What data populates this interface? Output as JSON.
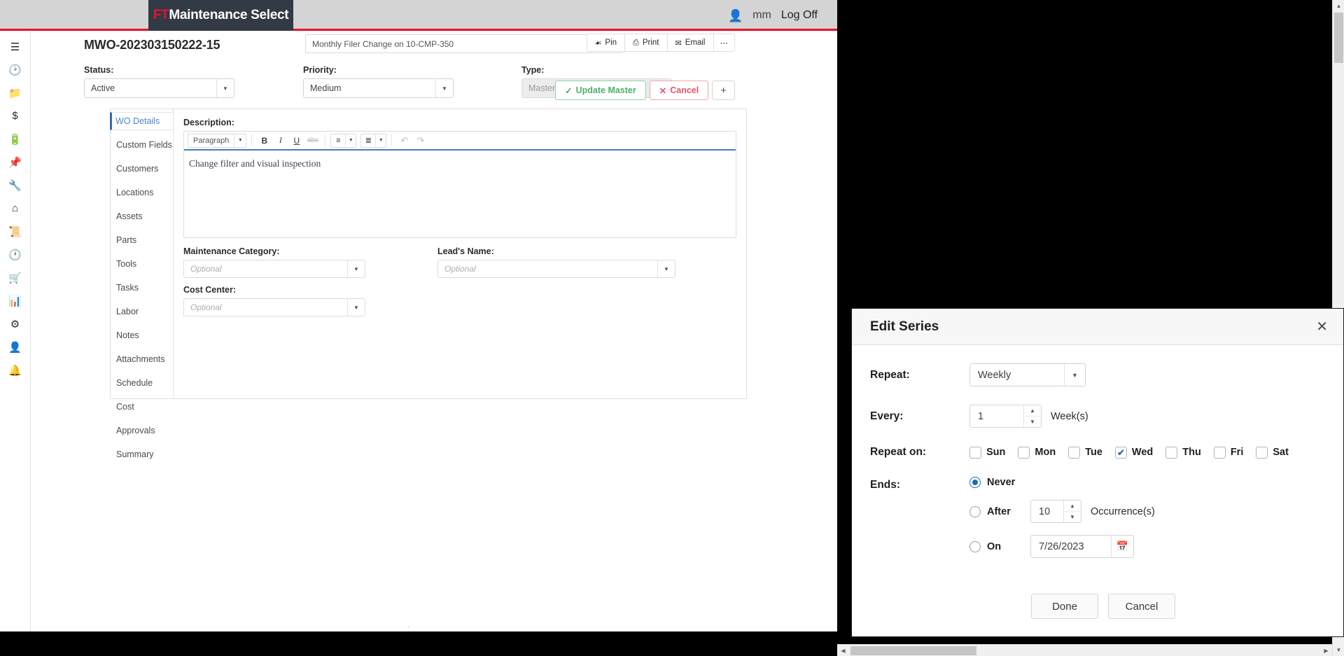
{
  "topbar": {
    "logo_prefix": "FT",
    "logo_rest": "Maintenance Select",
    "user_icon": "user-icon",
    "user_name": "mm",
    "logoff_label": "Log Off"
  },
  "rail": {
    "items": [
      {
        "name": "menu-hamburger",
        "glyph": "☰"
      },
      {
        "name": "clock",
        "glyph": "◴"
      },
      {
        "name": "folder",
        "glyph": "📁"
      },
      {
        "name": "dollar",
        "glyph": "$"
      },
      {
        "name": "battery",
        "glyph": "🗔"
      },
      {
        "name": "pin",
        "glyph": "📌"
      },
      {
        "name": "wrench",
        "glyph": "🔧"
      },
      {
        "name": "home",
        "glyph": "⌂"
      },
      {
        "name": "document",
        "glyph": "📑"
      },
      {
        "name": "history",
        "glyph": "◴"
      },
      {
        "name": "cart",
        "glyph": "🛒"
      },
      {
        "name": "chart",
        "glyph": "📊"
      },
      {
        "name": "gear",
        "glyph": "⚙"
      },
      {
        "name": "person",
        "glyph": "👤"
      },
      {
        "name": "bell",
        "glyph": "🔔"
      }
    ]
  },
  "work_order": {
    "id": "MWO-202303150222-15",
    "title": "Monthly Filer Change on 10-CMP-350",
    "header_actions": [
      {
        "name": "pin-button",
        "label": "Pin",
        "icon": "⍑"
      },
      {
        "name": "print-button",
        "label": "Print",
        "icon": "⎙"
      },
      {
        "name": "email-button",
        "label": "Email",
        "icon": "✉"
      },
      {
        "name": "more-button",
        "label": "⋯",
        "icon": ""
      }
    ],
    "fields": {
      "status_label": "Status:",
      "status_value": "Active",
      "priority_label": "Priority:",
      "priority_value": "Medium",
      "type_label": "Type:",
      "type_value": "Master"
    },
    "commit": {
      "update_label": "Update Master",
      "update_icon": "✓",
      "cancel_label": "Cancel",
      "cancel_icon": "✕",
      "add_label": "+"
    }
  },
  "tabs": [
    {
      "label": "WO Details",
      "active": true
    },
    {
      "label": "Custom Fields",
      "active": false
    },
    {
      "label": "Customers",
      "active": false
    },
    {
      "label": "Locations",
      "active": false
    },
    {
      "label": "Assets",
      "active": false
    },
    {
      "label": "Parts",
      "active": false
    },
    {
      "label": "Tools",
      "active": false
    },
    {
      "label": "Tasks",
      "active": false
    },
    {
      "label": "Labor",
      "active": false
    },
    {
      "label": "Notes",
      "active": false
    },
    {
      "label": "Attachments",
      "active": false
    },
    {
      "label": "Schedule",
      "active": false
    },
    {
      "label": "Cost",
      "active": false
    },
    {
      "label": "Approvals",
      "active": false
    },
    {
      "label": "Summary",
      "active": false
    }
  ],
  "wo_details": {
    "description_label": "Description:",
    "editor": {
      "paragraph_label": "Paragraph",
      "bold": "B",
      "italic": "I",
      "underline": "U",
      "strike": "abc",
      "bullet_list": "☰",
      "numbered_list": "≡",
      "undo": "↶",
      "redo": "↷"
    },
    "description_text": "Change filter and visual inspection",
    "maintenance_category_label": "Maintenance Category:",
    "maintenance_category_placeholder": "Optional",
    "leads_name_label": "Lead's Name:",
    "leads_name_placeholder": "Optional",
    "cost_center_label": "Cost Center:",
    "cost_center_placeholder": "Optional"
  },
  "dialog": {
    "title": "Edit Series",
    "close_icon": "✕",
    "repeat_label": "Repeat:",
    "repeat_value": "Weekly",
    "every_label": "Every:",
    "every_value": "1",
    "every_unit": "Week(s)",
    "repeat_on_label": "Repeat on:",
    "days": [
      {
        "label": "Sun",
        "checked": false
      },
      {
        "label": "Mon",
        "checked": false
      },
      {
        "label": "Tue",
        "checked": false
      },
      {
        "label": "Wed",
        "checked": true
      },
      {
        "label": "Thu",
        "checked": false
      },
      {
        "label": "Fri",
        "checked": false
      },
      {
        "label": "Sat",
        "checked": false
      }
    ],
    "check_glyph": "✔",
    "ends_label": "Ends:",
    "ends_never_label": "Never",
    "ends_never_selected": true,
    "ends_after_label": "After",
    "ends_after_value": "10",
    "ends_after_unit": "Occurrence(s)",
    "ends_on_label": "On",
    "ends_on_value": "7/26/2023",
    "calendar_icon": "Ὄ5",
    "done_label": "Done",
    "cancel_label": "Cancel"
  },
  "scrollbars": {
    "up": "▲",
    "down": "▼",
    "left": "◀",
    "right": "▶"
  },
  "colors": {
    "brand_red": "#e8112d",
    "logo_bg": "#323a45",
    "accent_blue": "#2f6fb5",
    "success_green": "#4caf6d",
    "danger_red": "#e8556a"
  }
}
